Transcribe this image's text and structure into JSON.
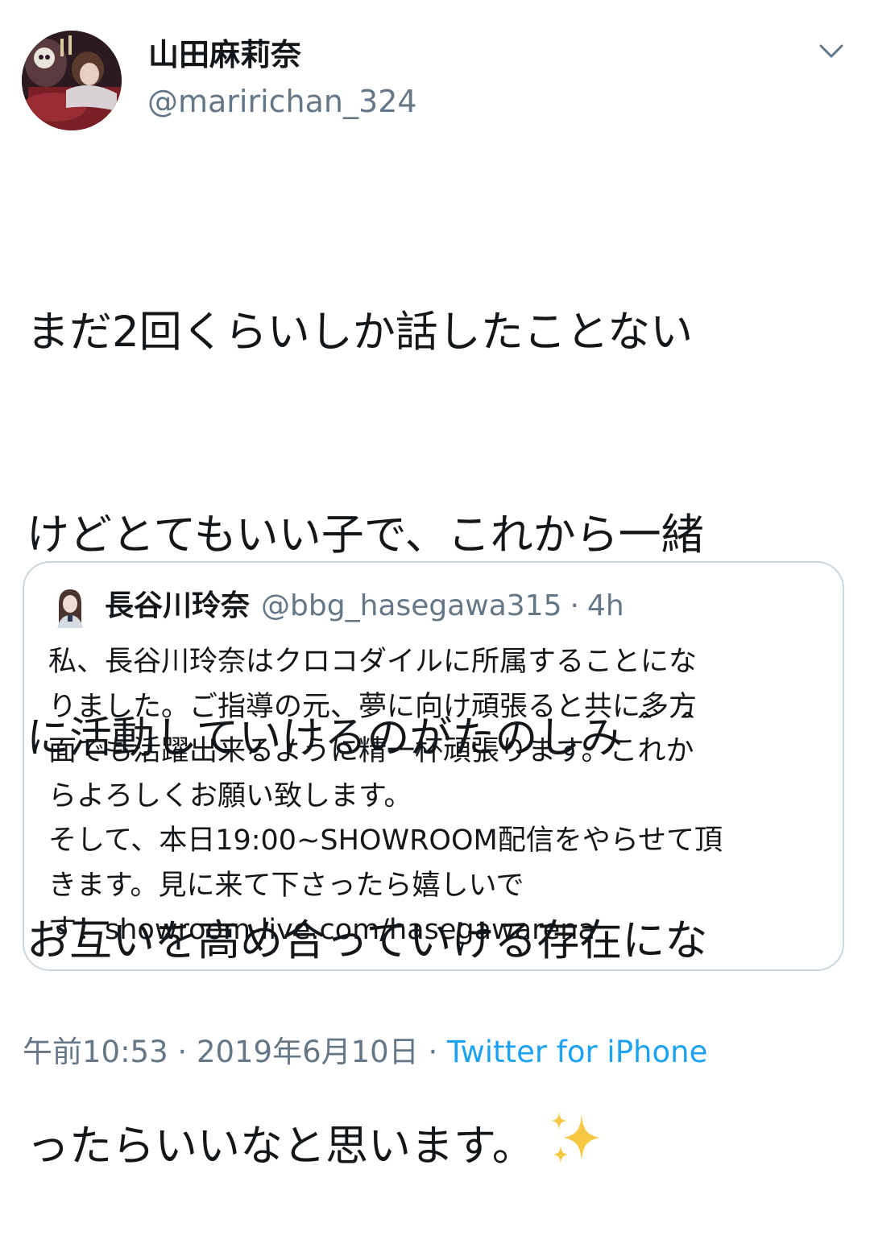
{
  "author": {
    "display_name": "山田麻莉奈",
    "screen_name": "@maririchan_324",
    "avatar": "profile-photo"
  },
  "menu": {
    "icon": "chevron-down-icon"
  },
  "tweet": {
    "lines": [
      "まだ2回くらいしか話したことない",
      "けどとてもいい子で、これから一緒",
      "に活動していけるのがたのしみ＾＾",
      "お互いを高め合っていける存在にな",
      "ったらいいなと思います。"
    ],
    "emoji": "sparkles-emoji"
  },
  "quoted": {
    "display_name": "長谷川玲奈",
    "screen_name": "@bbg_hasegawa315",
    "separator": "·",
    "time": "4h",
    "lines": [
      "私、長谷川玲奈はクロコダイルに所属することにな",
      "りました。ご指導の元、夢に向け頑張ると共に多方",
      "面でも活躍出来るように精一杯頑張ります。これか",
      "らよろしくお願い致します。",
      "そして、本日19:00~SHOWROOM配信をやらせて頂",
      "きます。見に来て下さったら嬉しいで",
      "す！showroom-live.com/hasegawarena"
    ]
  },
  "footer": {
    "time": "午前10:53",
    "separator": "·",
    "date": "2019年6月10日",
    "source": "Twitter for iPhone"
  },
  "colors": {
    "text": "#14171a",
    "secondary": "#657786",
    "link": "#1da1f2",
    "border": "#ccd6dd",
    "sparkle": "#f7c844"
  }
}
